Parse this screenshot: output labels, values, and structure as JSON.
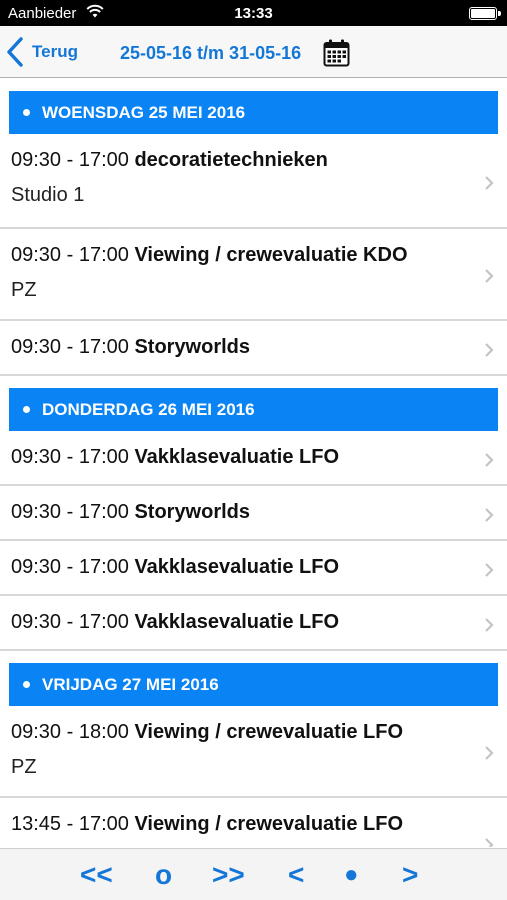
{
  "status_bar": {
    "carrier": "Aanbieder",
    "time": "13:33"
  },
  "nav": {
    "back_label": "Terug",
    "title": "25-05-16 t/m 31-05-16"
  },
  "days": [
    {
      "header": "WOENSDAG 25 MEI 2016",
      "events": [
        {
          "time": "09:30 - 17:00",
          "title": "decoratietechnieken",
          "location": "Studio 1"
        },
        {
          "time": "09:30 - 17:00",
          "title": "Viewing / crewevaluatie KDO",
          "location": "PZ"
        },
        {
          "time": "09:30 - 17:00",
          "title": "Storyworlds",
          "location": ""
        }
      ]
    },
    {
      "header": "DONDERDAG 26 MEI 2016",
      "events": [
        {
          "time": "09:30 - 17:00",
          "title": "Vakklasevaluatie LFO",
          "location": ""
        },
        {
          "time": "09:30 - 17:00",
          "title": "Storyworlds",
          "location": ""
        },
        {
          "time": "09:30 - 17:00",
          "title": "Vakklasevaluatie LFO",
          "location": ""
        },
        {
          "time": "09:30 - 17:00",
          "title": "Vakklasevaluatie LFO",
          "location": ""
        }
      ]
    },
    {
      "header": "VRIJDAG 27 MEI 2016",
      "events": [
        {
          "time": "09:30 - 18:00",
          "title": "Viewing / crewevaluatie LFO",
          "location": "PZ"
        },
        {
          "time": "13:45 - 17:00",
          "title": "Viewing / crewevaluatie LFO",
          "location": ""
        }
      ]
    }
  ],
  "toolbar": {
    "first_label": "<<",
    "current_label": "o",
    "last_label": ">>",
    "prev_label": "<",
    "today_label": "●",
    "next_label": ">"
  },
  "colors": {
    "accent": "#1477d8",
    "day_header_bg": "#0a84f5"
  },
  "icons": {
    "back": "chevron-left-icon",
    "calendar": "calendar-icon",
    "row": "chevron-right-icon",
    "wifi": "wifi-icon",
    "battery": "battery-icon"
  }
}
